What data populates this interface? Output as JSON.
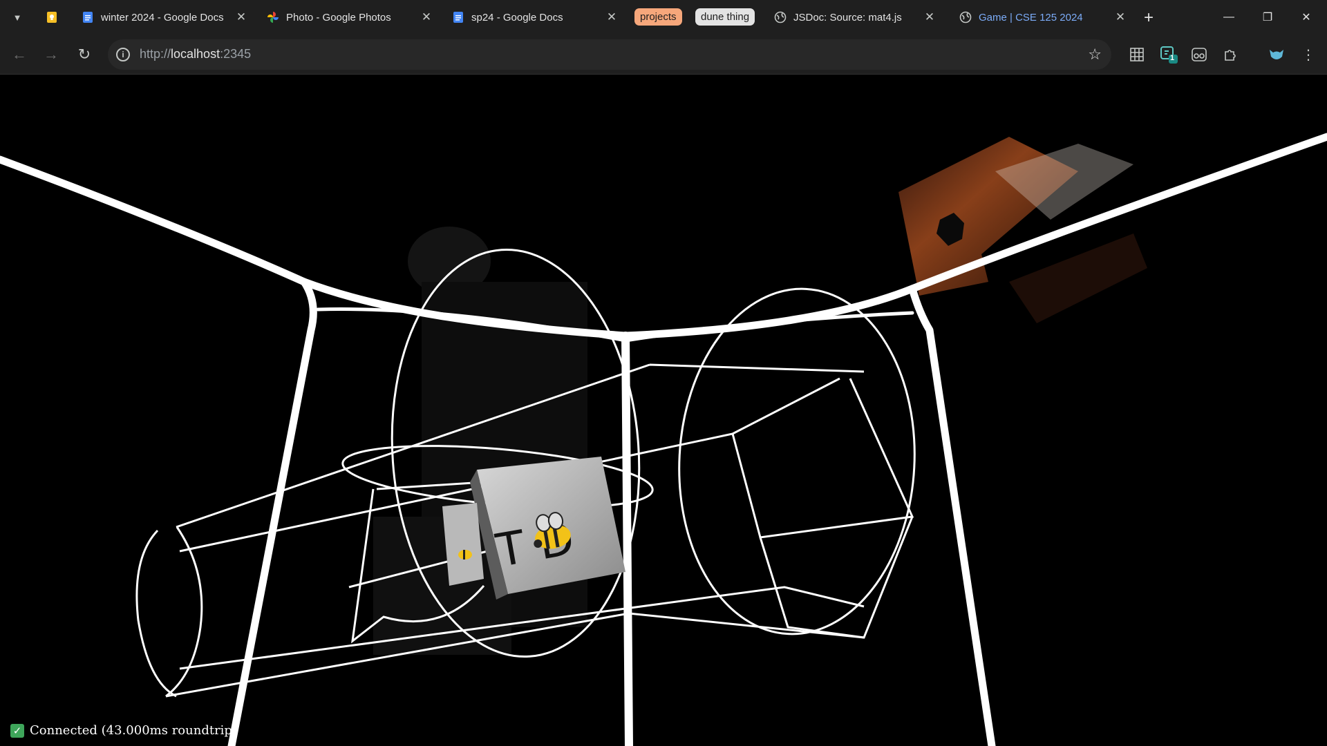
{
  "browser": {
    "tabs": [
      {
        "title": "winter 2024 - Google Docs",
        "favicon": "google-docs-icon",
        "close": "✕"
      },
      {
        "title": "Photo - Google Photos",
        "favicon": "google-photos-icon",
        "close": "✕"
      },
      {
        "title": "sp24 - Google Docs",
        "favicon": "google-docs-icon",
        "close": "✕"
      },
      {
        "title": "JSDoc: Source: mat4.js",
        "favicon": "globe-icon",
        "close": "✕"
      },
      {
        "title": "Game | CSE 125 2024",
        "favicon": "globe-icon",
        "close": "✕",
        "active": true
      }
    ],
    "tab_groups": [
      {
        "label": "projects",
        "color": "#f6a77b"
      },
      {
        "label": "dune thing",
        "color": "#e3e3e3"
      }
    ],
    "new_tab": "+",
    "window_controls": {
      "minimize": "—",
      "restore": "❐",
      "close": "✕"
    },
    "address_bar": {
      "scheme": "http://",
      "host": "localhost",
      "port": ":2345"
    },
    "extension_badge": "1"
  },
  "colors": {
    "chrome_bg": "#1f1f1f",
    "omnibox_bg": "#282828",
    "active_tab_text": "#7cacf8",
    "status_check": "#3ea55a"
  },
  "game": {
    "status_text": "Connected (43.000ms roundtrip)",
    "sign_text": "T D"
  }
}
